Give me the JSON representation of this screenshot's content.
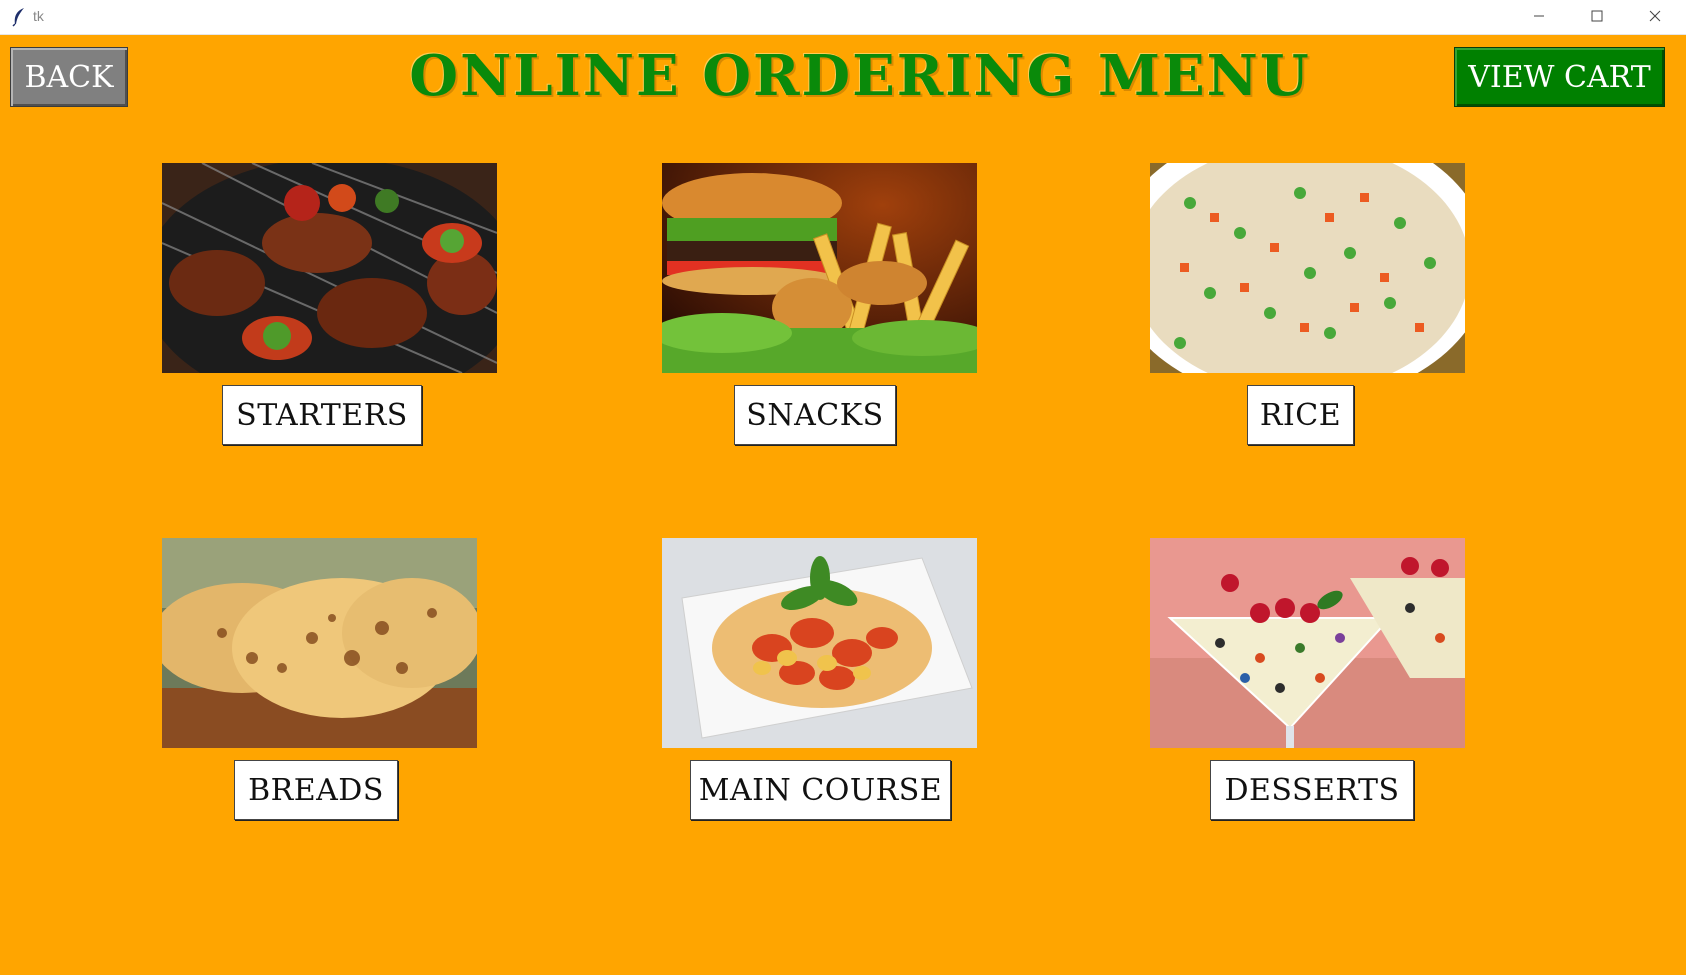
{
  "window": {
    "title": "tk"
  },
  "header": {
    "back_label": "BACK",
    "title": "ONLINE ORDERING MENU",
    "cart_label": "VIEW CART"
  },
  "categories": [
    {
      "label": "STARTERS",
      "image_icon": "grilled-meat-image"
    },
    {
      "label": "SNACKS",
      "image_icon": "burger-fries-image"
    },
    {
      "label": "RICE",
      "image_icon": "fried-rice-image"
    },
    {
      "label": "BREADS",
      "image_icon": "naan-bread-image"
    },
    {
      "label": "MAIN COURSE",
      "image_icon": "pasta-plate-image"
    },
    {
      "label": "DESSERTS",
      "image_icon": "dessert-glasses-image"
    }
  ],
  "colors": {
    "background": "#ffa500",
    "title": "#0a8a0a",
    "back_button": "#808080",
    "cart_button": "#008000"
  }
}
